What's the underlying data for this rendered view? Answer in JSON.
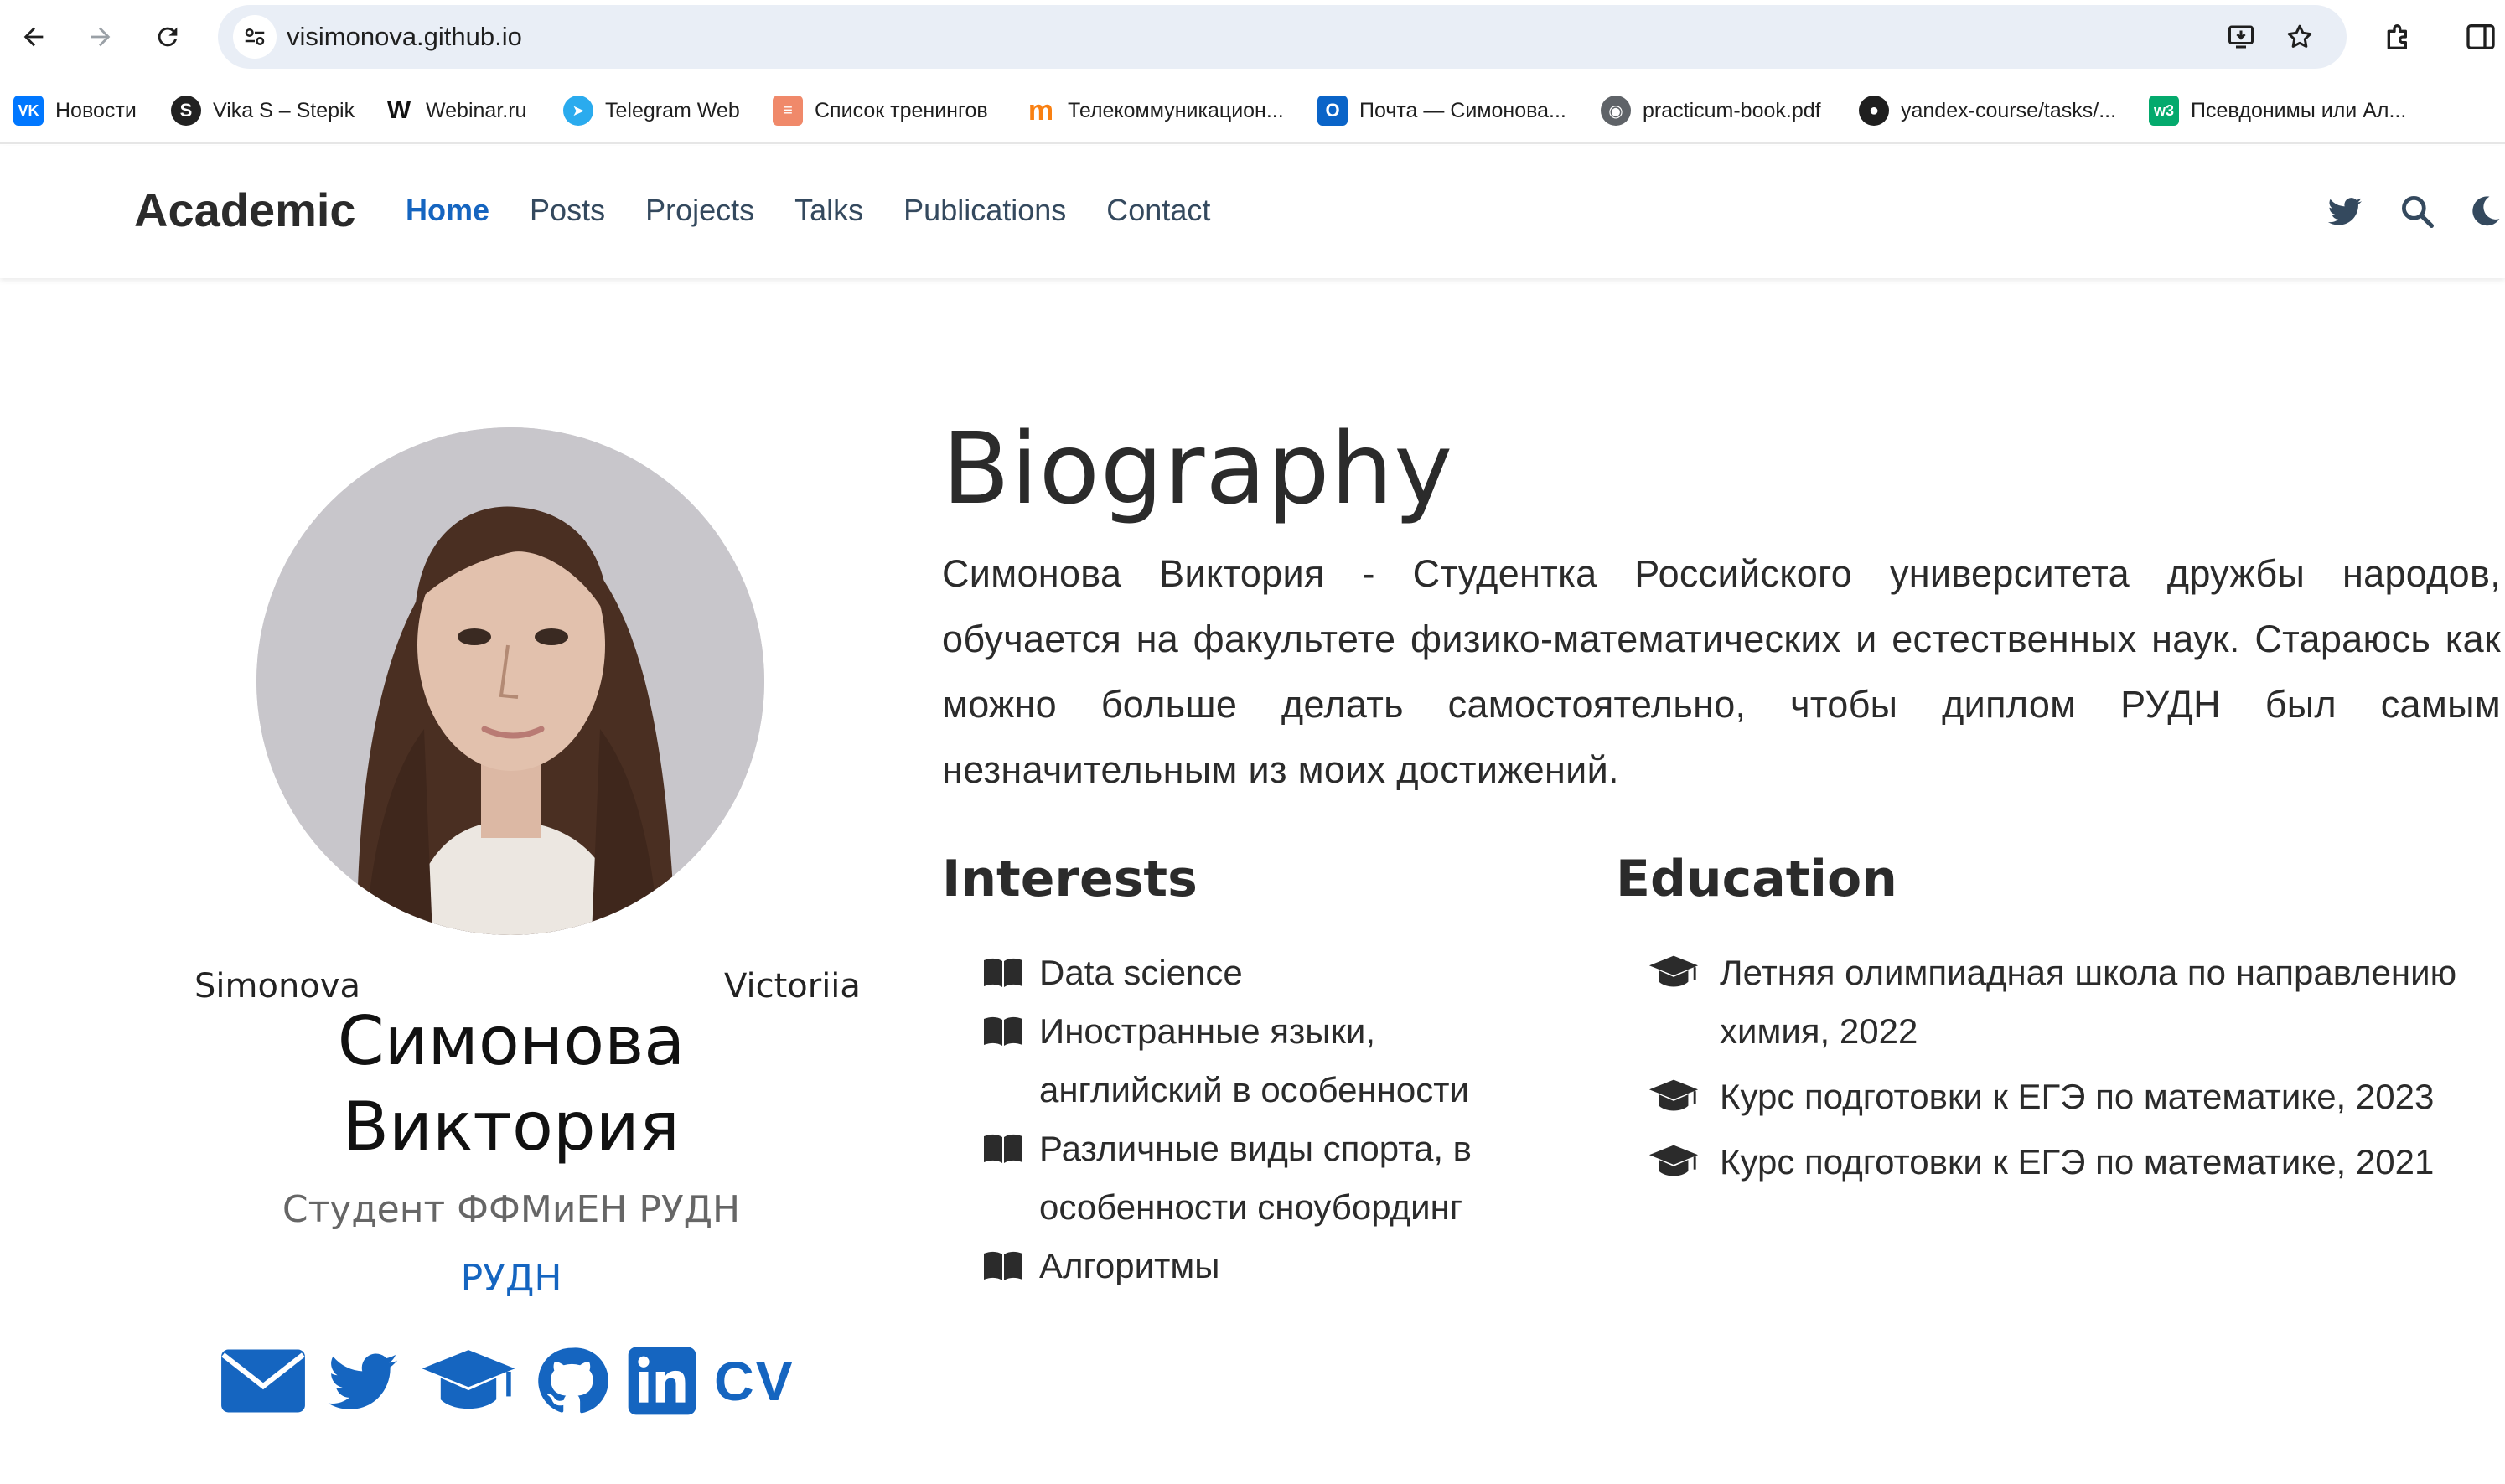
{
  "browser": {
    "url": "visimonova.github.io",
    "bookmarks": [
      {
        "label": "Новости",
        "icon": "vk-icon",
        "color": "#0077ff",
        "glyph": "VK"
      },
      {
        "label": "Vika S – Stepik",
        "icon": "stepik-icon",
        "color": "#222222",
        "glyph": "S"
      },
      {
        "label": "Webinar.ru",
        "icon": "webinar-icon",
        "color": "#ffffff",
        "glyph": "W"
      },
      {
        "label": "Telegram Web",
        "icon": "telegram-icon",
        "color": "#2aabee",
        "glyph": "➤"
      },
      {
        "label": "Список тренингов",
        "icon": "training-icon",
        "color": "#f0896a",
        "glyph": "≡"
      },
      {
        "label": "Телекоммуникацион...",
        "icon": "moodle-icon",
        "color": "#f98012",
        "glyph": "m"
      },
      {
        "label": "Почта — Симонова...",
        "icon": "outlook-icon",
        "color": "#0a64c8",
        "glyph": "O"
      },
      {
        "label": "practicum-book.pdf",
        "icon": "globe-icon",
        "color": "#5f6368",
        "glyph": "◉"
      },
      {
        "label": "yandex-course/tasks/...",
        "icon": "github-icon",
        "color": "#1f1f1f",
        "glyph": "●"
      },
      {
        "label": "Псевдонимы или Ал...",
        "icon": "w3schools-icon",
        "color": "#04aa6d",
        "glyph": "w3"
      }
    ]
  },
  "site": {
    "brand": "Academic",
    "menu": [
      "Home",
      "Posts",
      "Projects",
      "Talks",
      "Publications",
      "Contact"
    ],
    "active_menu": "Home",
    "accent_color": "#1565c0"
  },
  "profile": {
    "first_name_latin": "Simonova",
    "last_name_latin": "Victoriia",
    "name": "Симонова Виктория",
    "role": "Студент ФФМиЕН РУДН",
    "organization": "РУДН",
    "social_links": [
      "envelope-icon",
      "twitter-icon",
      "graduation-cap-icon",
      "github-icon",
      "linkedin-icon"
    ],
    "cv_label": "CV"
  },
  "biography": {
    "title": "Biography",
    "text": "Симонова Виктория - Студентка Российского университета дружбы народов, обучается на факультете физико-математических и естественных наук. Стараюсь как можно больше делать самостоятельно, чтобы диплом РУДН был самым незначительным из моих достижений."
  },
  "interests": {
    "title": "Interests",
    "items": [
      "Data science",
      "Иностранные языки, английский в особенности",
      "Различные виды спорта, в особенности сноубординг",
      "Алгоритмы"
    ]
  },
  "education": {
    "title": "Education",
    "items": [
      "Летняя олимпиадная школа по направлению химия, 2022",
      "Курс подготовки к ЕГЭ по математике, 2023",
      "Курс подготовки к ЕГЭ по математике, 2021"
    ]
  }
}
